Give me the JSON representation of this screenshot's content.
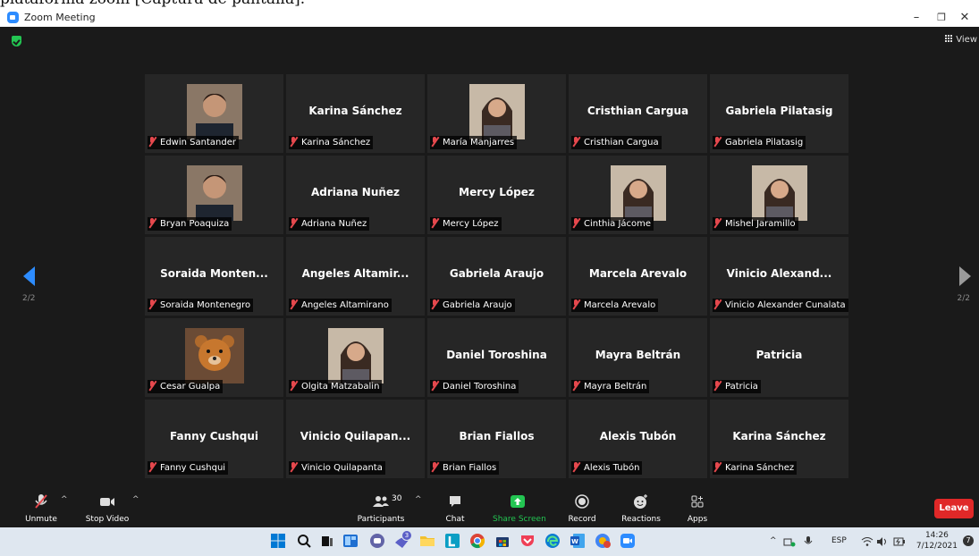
{
  "caption": "plataforma zoom [Captura de pantalla].",
  "window": {
    "title": "Zoom Meeting",
    "minimize": "–",
    "restore": "❐",
    "close": "✕"
  },
  "top": {
    "view_label": "View"
  },
  "pager": {
    "left": "2/2",
    "right": "2/2"
  },
  "participants": [
    {
      "display": "",
      "label": "Edwin Santander",
      "photo": "man-photo"
    },
    {
      "display": "Karina Sánchez",
      "label": "Karina Sánchez"
    },
    {
      "display": "",
      "label": "María Manjarres",
      "photo": "woman-photo"
    },
    {
      "display": "Cristhian Cargua",
      "label": "Cristhian Cargua"
    },
    {
      "display": "Gabriela Pilatasig",
      "label": "Gabriela Pilatasig"
    },
    {
      "display": "",
      "label": "Bryan Poaquiza",
      "photo": "man-photo"
    },
    {
      "display": "Adriana Nuñez",
      "label": "Adriana Nuñez"
    },
    {
      "display": "Mercy López",
      "label": "Mercy López"
    },
    {
      "display": "",
      "label": "Cinthia Jácome",
      "photo": "woman-photo"
    },
    {
      "display": "",
      "label": "Mishel Jaramillo",
      "photo": "woman-photo"
    },
    {
      "display": "Soraida Monten...",
      "label": "Soraida Montenegro"
    },
    {
      "display": "Angeles Altamir...",
      "label": "Angeles Altamirano"
    },
    {
      "display": "Gabriela Araujo",
      "label": "Gabriela Araujo"
    },
    {
      "display": "Marcela Arevalo",
      "label": "Marcela Arevalo"
    },
    {
      "display": "Vinicio Alexand...",
      "label": "Vinicio Alexander Cunalata"
    },
    {
      "display": "",
      "label": "Cesar Gualpa",
      "photo": "teddy-bear-photo"
    },
    {
      "display": "",
      "label": "Olgita Matzabalin",
      "photo": "woman-photo"
    },
    {
      "display": "Daniel Toroshina",
      "label": "Daniel Toroshina"
    },
    {
      "display": "Mayra Beltrán",
      "label": "Mayra Beltrán"
    },
    {
      "display": "Patricia",
      "label": "Patricia"
    },
    {
      "display": "Fanny Cushqui",
      "label": "Fanny Cushqui"
    },
    {
      "display": "Vinicio Quilapan...",
      "label": "Vinicio Quilapanta"
    },
    {
      "display": "Brian Fiallos",
      "label": "Brian Fiallos"
    },
    {
      "display": "Alexis Tubón",
      "label": "Alexis Tubón"
    },
    {
      "display": "Karina Sánchez",
      "label": "Karina Sánchez"
    }
  ],
  "toolbar": {
    "unmute": "Unmute",
    "stop_video": "Stop Video",
    "participants": "Participants",
    "participants_count": "30",
    "chat": "Chat",
    "share_screen": "Share Screen",
    "record": "Record",
    "reactions": "Reactions",
    "apps": "Apps",
    "leave": "Leave"
  },
  "taskbar": {
    "lang": "ESP",
    "time": "14:26",
    "date": "7/12/2021",
    "notifications": "7",
    "teams_badge": "3"
  },
  "colors": {
    "accent": "#2d8cff",
    "leave": "#e02828",
    "share": "#23c552",
    "muted": "#e5484d"
  }
}
